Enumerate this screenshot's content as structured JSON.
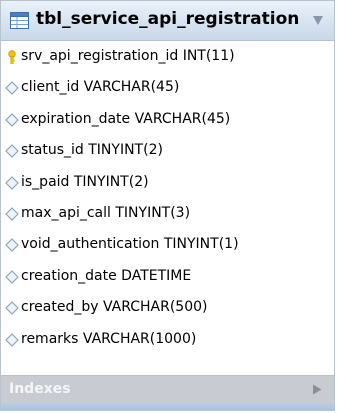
{
  "table": {
    "name": "tbl_service_api_registration",
    "columns": [
      {
        "label": "srv_api_registration_id INT(11)",
        "icon": "primary-key-icon"
      },
      {
        "label": "client_id VARCHAR(45)",
        "icon": "column-diamond-icon"
      },
      {
        "label": "expiration_date VARCHAR(45)",
        "icon": "column-diamond-icon"
      },
      {
        "label": "status_id TINYINT(2)",
        "icon": "column-diamond-icon"
      },
      {
        "label": "is_paid TINYINT(2)",
        "icon": "column-diamond-icon"
      },
      {
        "label": "max_api_call TINYINT(3)",
        "icon": "column-diamond-icon"
      },
      {
        "label": "void_authentication TINYINT(1)",
        "icon": "column-diamond-icon"
      },
      {
        "label": "creation_date DATETIME",
        "icon": "column-diamond-icon"
      },
      {
        "label": "created_by VARCHAR(500)",
        "icon": "column-diamond-icon"
      },
      {
        "label": "remarks VARCHAR(1000)",
        "icon": "column-diamond-icon"
      }
    ],
    "indexes_label": "Indexes"
  },
  "icons": {
    "table": "table-icon",
    "collapse": "triangle-down-icon",
    "expand": "triangle-right-icon"
  },
  "colors": {
    "header_gradient_top": "#eaf1f9",
    "header_gradient_bottom": "#c9d8ea",
    "key_icon": "#f2c200",
    "diamond_stroke": "#8fa5bd",
    "indexes_bar": "#c8ccd2"
  }
}
